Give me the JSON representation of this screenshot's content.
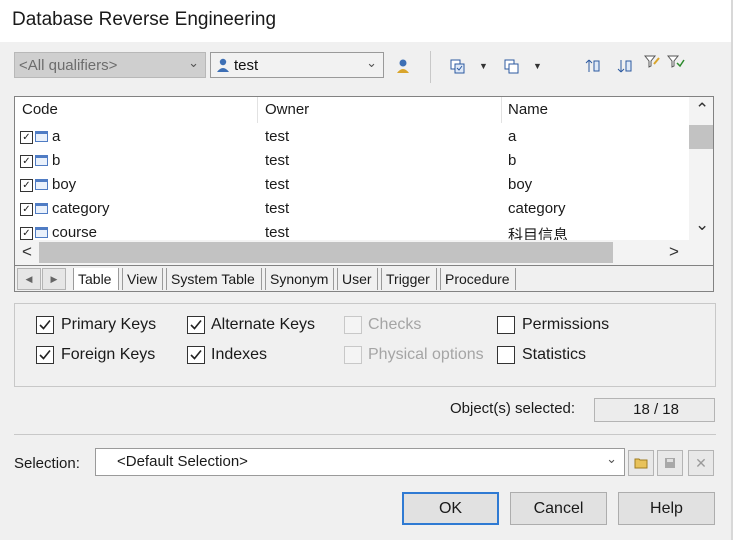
{
  "window": {
    "title": "Database Reverse Engineering"
  },
  "toolbar": {
    "qualifier": {
      "value": "<All qualifiers>"
    },
    "owner": {
      "value": "test"
    },
    "icons": [
      "user-select-icon",
      "select-all-icon",
      "deselect-all-icon",
      "move-up-icon",
      "move-down-icon",
      "filter-icon",
      "filter-clear-icon"
    ]
  },
  "table": {
    "columns": [
      "Code",
      "Owner",
      "Name"
    ],
    "rows": [
      {
        "code": "a",
        "owner": "test",
        "name": "a",
        "checked": true
      },
      {
        "code": "b",
        "owner": "test",
        "name": "b",
        "checked": true
      },
      {
        "code": "boy",
        "owner": "test",
        "name": "boy",
        "checked": true
      },
      {
        "code": "category",
        "owner": "test",
        "name": "category",
        "checked": true
      },
      {
        "code": "course",
        "owner": "test",
        "name": "科目信息",
        "checked": true
      }
    ]
  },
  "tabs": [
    "Table",
    "View",
    "System Table",
    "Synonym",
    "User",
    "Trigger",
    "Procedure"
  ],
  "options": {
    "primary_keys": {
      "label": "Primary Keys",
      "checked": true,
      "enabled": true
    },
    "foreign_keys": {
      "label": "Foreign Keys",
      "checked": true,
      "enabled": true
    },
    "alternate_keys": {
      "label": "Alternate Keys",
      "checked": true,
      "enabled": true
    },
    "indexes": {
      "label": "Indexes",
      "checked": true,
      "enabled": true
    },
    "checks": {
      "label": "Checks",
      "checked": false,
      "enabled": false
    },
    "physical_options": {
      "label": "Physical options",
      "checked": false,
      "enabled": false
    },
    "permissions": {
      "label": "Permissions",
      "checked": false,
      "enabled": true
    },
    "statistics": {
      "label": "Statistics",
      "checked": false,
      "enabled": true
    }
  },
  "selected": {
    "label": "Object(s) selected:",
    "value": "18 / 18"
  },
  "selection": {
    "label": "Selection:",
    "value": "<Default Selection>"
  },
  "buttons": {
    "ok": "OK",
    "cancel": "Cancel",
    "help": "Help"
  },
  "colors": {
    "accent": "#2f7ad3",
    "icon_blue": "#2c5aa0"
  }
}
